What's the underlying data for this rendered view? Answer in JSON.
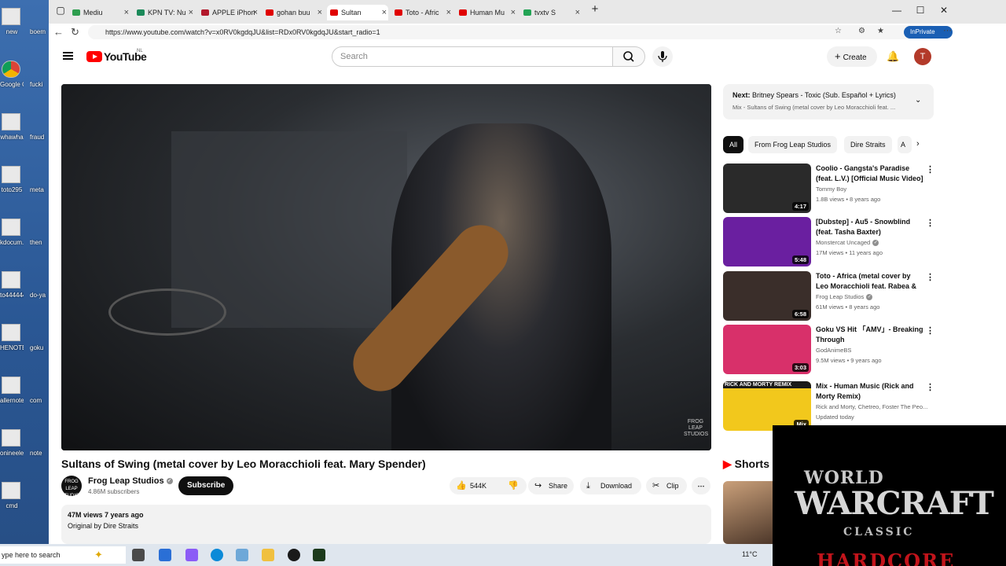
{
  "desktop": {
    "icons": [
      {
        "label": "new",
        "label2": "boem"
      },
      {
        "label": "Google Chrome",
        "label2": "fucki"
      },
      {
        "label": "whawha",
        "label2": "fraud"
      },
      {
        "label": "toto295",
        "label2": "meta"
      },
      {
        "label": "kdocum...",
        "label2": "then"
      },
      {
        "label": "to444444",
        "label2": "do-ya"
      },
      {
        "label": "HENOTE",
        "label2": "goku"
      },
      {
        "label": "allernote",
        "label2": "com"
      },
      {
        "label": "onineele...",
        "label2": "note"
      },
      {
        "label": "cmd",
        "label2": ""
      }
    ]
  },
  "browser": {
    "tabs": [
      {
        "label": "Mediu",
        "color": "#2e9e4f"
      },
      {
        "label": "KPN TV: Nu",
        "color": "#1c8a5a"
      },
      {
        "label": "APPLE iPhon",
        "color": "#b2182b"
      },
      {
        "label": "gohan buu",
        "color": "#e00000"
      },
      {
        "label": "Sultan",
        "color": "#e00000",
        "active": true
      },
      {
        "label": "Toto - Afric",
        "color": "#e00000"
      },
      {
        "label": "Human Mu",
        "color": "#e00000"
      },
      {
        "label": "tvxtv S",
        "color": "#23a455"
      }
    ],
    "url": "https://www.youtube.com/watch?v=x0RV0kgdqJU&list=RDx0RV0kgdqJU&start_radio=1",
    "inprivate_label": "InPrivate"
  },
  "youtube": {
    "logo_text": "YouTube",
    "logo_country": "NL",
    "search_placeholder": "Search",
    "create_label": "Create",
    "avatar_letter": "T",
    "video": {
      "title": "Sultans of Swing (metal cover by Leo Moracchioli feat. Mary Spender)",
      "watermark": "FROG LEAP STUDIOS",
      "channel": "Frog Leap Studios",
      "channel_avatar": "FROG LEAP STUDIOS",
      "subscribers": "4.86M subscribers",
      "subscribe_label": "Subscribe",
      "likes": "544K",
      "share_label": "Share",
      "download_label": "Download",
      "clip_label": "Clip",
      "views_date": "47M views  7 years ago",
      "desc_line": "Original by Dire Straits"
    },
    "next": {
      "prefix": "Next:",
      "title": "Britney Spears - Toxic (Sub. Español + Lyrics)",
      "subtitle": "Mix - Sultans of Swing (metal cover by Leo Moracchioli feat. ..."
    },
    "chips": [
      "All",
      "From Frog Leap Studios",
      "Dire Straits",
      "A"
    ],
    "recommendations": [
      {
        "title": "Coolio - Gangsta's Paradise (feat. L.V.) [Official Music Video]",
        "channel": "Tommy Boy",
        "verified": false,
        "meta": "1.8B views • 8 years ago",
        "duration": "4:17",
        "thumb_color": "#2a2a2a"
      },
      {
        "title": "[Dubstep] - Au5 - Snowblind (feat. Tasha Baxter) [Monstercat...",
        "channel": "Monstercat Uncaged",
        "verified": true,
        "meta": "17M views • 11 years ago",
        "duration": "5:48",
        "thumb_color": "#6a1fa0"
      },
      {
        "title": "Toto - Africa (metal cover by Leo Moracchioli feat. Rabea & ...",
        "channel": "Frog Leap Studios",
        "verified": true,
        "meta": "61M views • 8 years ago",
        "duration": "6:58",
        "thumb_color": "#3a2e2a"
      },
      {
        "title": "Goku VS Hit 「AMV」- Breaking Through",
        "channel": "GodAnimeBS",
        "verified": false,
        "meta": "9.5M views • 9 years ago",
        "duration": "3:03",
        "thumb_color": "#d8306a"
      },
      {
        "title": "Mix - Human Music (Rick and Morty Remix)",
        "channel": "Rick and Morty, Chetreo, Foster The Peo...",
        "verified": false,
        "meta": "Updated today",
        "duration": "Mix",
        "thumb_color": "#f2c81c",
        "thumb_label": "RICK AND MORTY REMIX"
      }
    ],
    "shorts_label": "Shorts"
  },
  "overlay": {
    "line1": "WORLD",
    "line2": "WARCRAFT",
    "line3": "CLASSIC",
    "line4": "HARDCORE"
  },
  "taskbar": {
    "search_placeholder": "ype here to search",
    "temperature": "11°C"
  }
}
